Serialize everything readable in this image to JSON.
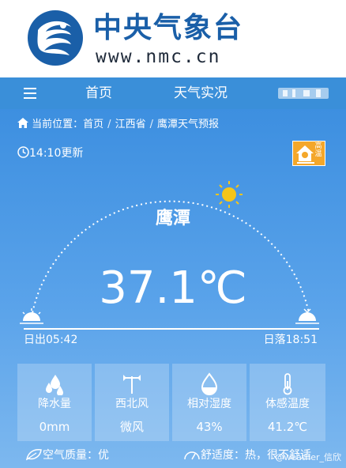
{
  "header": {
    "site_name": "中央气象台",
    "site_url": "www.nmc.cn"
  },
  "nav": {
    "items": [
      "首页",
      "天气实况"
    ]
  },
  "breadcrumb": {
    "prefix": "当前位置：",
    "items": [
      "首页",
      "江西省",
      "鹰潭天气预报"
    ]
  },
  "update_time": "14:10更新",
  "alert": {
    "level": "高温",
    "color": "#f4a72a"
  },
  "city": "鹰潭",
  "temperature": "37.1℃",
  "sun": {
    "sunrise": "日出05:42",
    "sunset": "日落18:51"
  },
  "metrics": [
    {
      "icon": "raindrops-icon",
      "label": "降水量",
      "value": "0mm"
    },
    {
      "icon": "wind-vane-icon",
      "label": "西北风",
      "value": "微风"
    },
    {
      "icon": "humidity-drop-icon",
      "label": "相对湿度",
      "value": "43%"
    },
    {
      "icon": "thermometer-icon",
      "label": "体感温度",
      "value": "41.2℃"
    }
  ],
  "footer": {
    "air_quality": "空气质量：优",
    "comfort_label": "舒适度：",
    "comfort_value": "热，很不舒适"
  },
  "watermark": "@weather_信欣"
}
